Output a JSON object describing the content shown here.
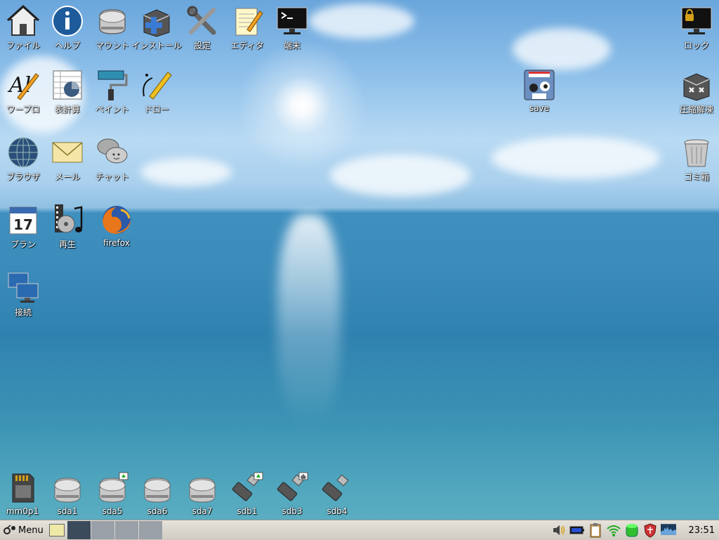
{
  "desktop": {
    "icons": {
      "file": "ファイル",
      "help": "ヘルプ",
      "mount": "マウント",
      "install": "インストール",
      "settings": "設定",
      "editor": "エディタ",
      "terminal": "端末",
      "lock": "ロック",
      "wordpro": "ワープロ",
      "spreadsheet": "表計算",
      "paint": "ペイント",
      "draw": "ドロー",
      "save": "save",
      "archive": "圧縮解凍",
      "browser": "ブラウザ",
      "mail": "メール",
      "chat": "チャット",
      "trash": "ゴミ箱",
      "plan": "プラン",
      "play": "再生",
      "firefox": "firefox",
      "connect": "接続"
    },
    "calendar_day": "17",
    "drives": [
      "mm0p1",
      "sda1",
      "sda5",
      "sda6",
      "sda7",
      "sdb1",
      "sdb3",
      "sdb4"
    ]
  },
  "taskbar": {
    "menu_label": "Menu",
    "clock": "23:51"
  },
  "colors": {
    "taskbar": "#d9d6ce",
    "desktop_pager_active": "#3b4b5b",
    "desktop_pager": "#9aa0a8"
  }
}
